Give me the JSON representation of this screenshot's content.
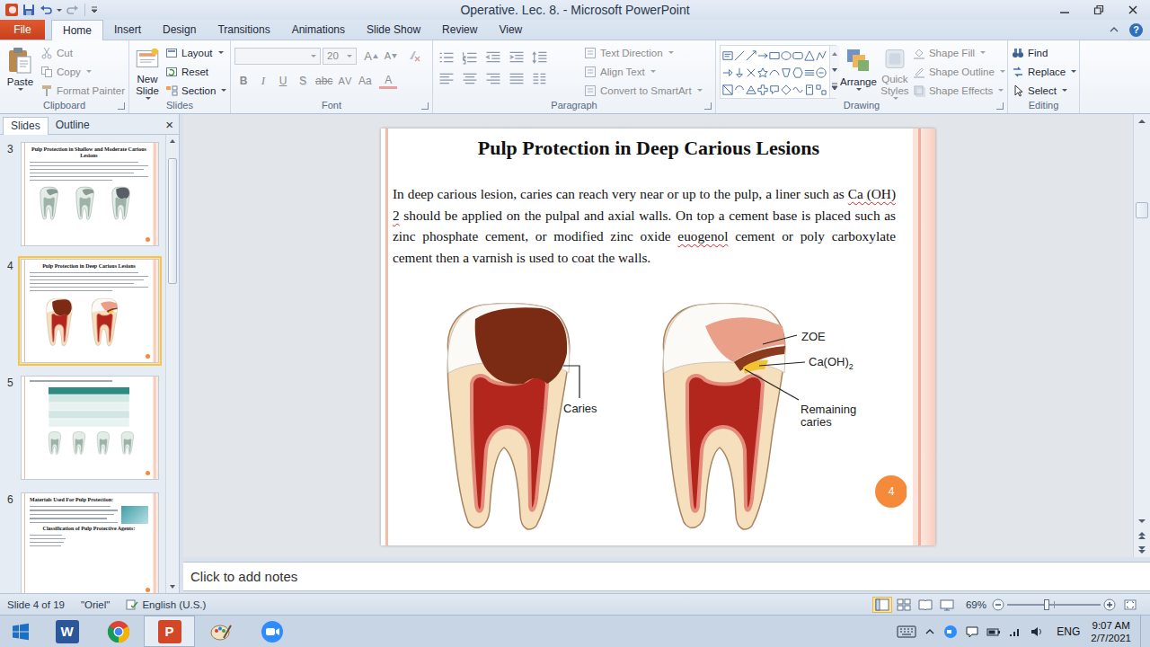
{
  "window": {
    "title": "Operative. Lec. 8. - Microsoft PowerPoint"
  },
  "ribbon_tabs": [
    {
      "label": "File",
      "selected": false,
      "kind": "backstage"
    },
    {
      "label": "Home",
      "selected": true,
      "kind": "tab"
    },
    {
      "label": "Insert",
      "selected": false,
      "kind": "tab"
    },
    {
      "label": "Design",
      "selected": false,
      "kind": "tab"
    },
    {
      "label": "Transitions",
      "selected": false,
      "kind": "tab"
    },
    {
      "label": "Animations",
      "selected": false,
      "kind": "tab"
    },
    {
      "label": "Slide Show",
      "selected": false,
      "kind": "tab"
    },
    {
      "label": "Review",
      "selected": false,
      "kind": "tab"
    },
    {
      "label": "View",
      "selected": false,
      "kind": "tab"
    }
  ],
  "help": "?",
  "clipboard": {
    "label": "Clipboard",
    "paste": {
      "label": "Paste",
      "disabled": false,
      "dropdown": true
    },
    "items": [
      {
        "label": "Cut",
        "disabled": true,
        "dropdown": false
      },
      {
        "label": "Copy",
        "disabled": true,
        "dropdown": true
      },
      {
        "label": "Format Painter",
        "disabled": true,
        "dropdown": false
      }
    ]
  },
  "slides_group": {
    "label": "Slides",
    "new_slide": {
      "label": "New Slide",
      "disabled": false,
      "dropdown": true
    },
    "items": [
      {
        "label": "Layout",
        "disabled": false,
        "dropdown": true
      },
      {
        "label": "Reset",
        "disabled": false,
        "dropdown": false
      },
      {
        "label": "Section",
        "disabled": false,
        "dropdown": true
      }
    ]
  },
  "font": {
    "label": "Font",
    "name": "",
    "size": "20",
    "disabled": true,
    "size_buttons": [
      "A",
      "A"
    ],
    "format_buttons": [
      "B",
      "I",
      "U",
      "S",
      "abc",
      "AV",
      "Aa",
      "A"
    ]
  },
  "paragraph": {
    "label": "Paragraph",
    "disabled": true,
    "items": [
      {
        "label": "Text Direction",
        "dropdown": true
      },
      {
        "label": "Align Text",
        "dropdown": true
      },
      {
        "label": "Convert to SmartArt",
        "dropdown": true
      }
    ]
  },
  "drawing": {
    "label": "Drawing",
    "arrange": {
      "label": "Arrange",
      "disabled": false
    },
    "quick_styles": {
      "label": "Quick Styles",
      "disabled": true
    },
    "items": [
      {
        "label": "Shape Fill",
        "disabled": true
      },
      {
        "label": "Shape Outline",
        "disabled": true
      },
      {
        "label": "Shape Effects",
        "disabled": true
      }
    ]
  },
  "editing": {
    "label": "Editing",
    "items": [
      {
        "label": "Find",
        "dropdown": false
      },
      {
        "label": "Replace",
        "dropdown": true
      },
      {
        "label": "Select",
        "dropdown": true
      }
    ]
  },
  "slides_panel": {
    "tabs": [
      {
        "label": "Slides",
        "selected": true
      },
      {
        "label": "Outline",
        "selected": false
      }
    ],
    "close": "×",
    "thumbnails": [
      {
        "number": "3",
        "title": "Pulp Protection in Shallow and Moderate Carious Lesions",
        "kind": "teeth-row",
        "selected": false
      },
      {
        "number": "4",
        "title": "Pulp Protection in Deep Carious Lesions",
        "kind": "teeth-pair",
        "selected": true
      },
      {
        "number": "5",
        "kind": "table",
        "selected": false
      },
      {
        "number": "6",
        "title": "Materials Used For Pulp Protection:",
        "subtitle": "Classification of Pulp Protective Agents:",
        "kind": "text",
        "selected": false
      }
    ]
  },
  "slide": {
    "title": "Pulp Protection in Deep Carious Lesions",
    "body": [
      {
        "text": "In deep carious lesion, caries can reach very near or up to the pulp, a liner such as ",
        "misspelled": false
      },
      {
        "text": "Ca (OH) 2",
        "misspelled": true
      },
      {
        "text": " should be applied on the pulpal and axial walls. On top a cement base is placed such as zinc phosphate cement, or modified zinc oxide ",
        "misspelled": false
      },
      {
        "text": "euogenol",
        "misspelled": true
      },
      {
        "text": " cement or poly carboxylate cement then a varnish is used to coat the walls.",
        "misspelled": false
      }
    ],
    "labels": {
      "caries": "Caries",
      "zoe": "ZOE",
      "caoh": "Ca(OH)",
      "caoh_sub": "2",
      "remaining": [
        "Remaining",
        "caries"
      ]
    },
    "page": "4"
  },
  "notes": {
    "placeholder": "Click to add notes"
  },
  "status_bar": {
    "items": [
      "Slide 4 of 19",
      "\"Oriel\"",
      "English (U.S.)"
    ],
    "views": [
      {
        "selected": true
      },
      {
        "selected": false
      },
      {
        "selected": false
      },
      {
        "selected": false
      }
    ],
    "zoom": "69%",
    "zoom_level": 0.42
  },
  "taskbar": {
    "apps": [
      {
        "badge": "W",
        "selected": false
      },
      {
        "badge": "",
        "selected": false
      },
      {
        "badge": "P",
        "selected": true
      },
      {
        "badge": "",
        "selected": false
      },
      {
        "badge": "",
        "selected": false
      }
    ],
    "language": "ENG",
    "time": "9:07 AM",
    "date": "2/7/2021"
  }
}
